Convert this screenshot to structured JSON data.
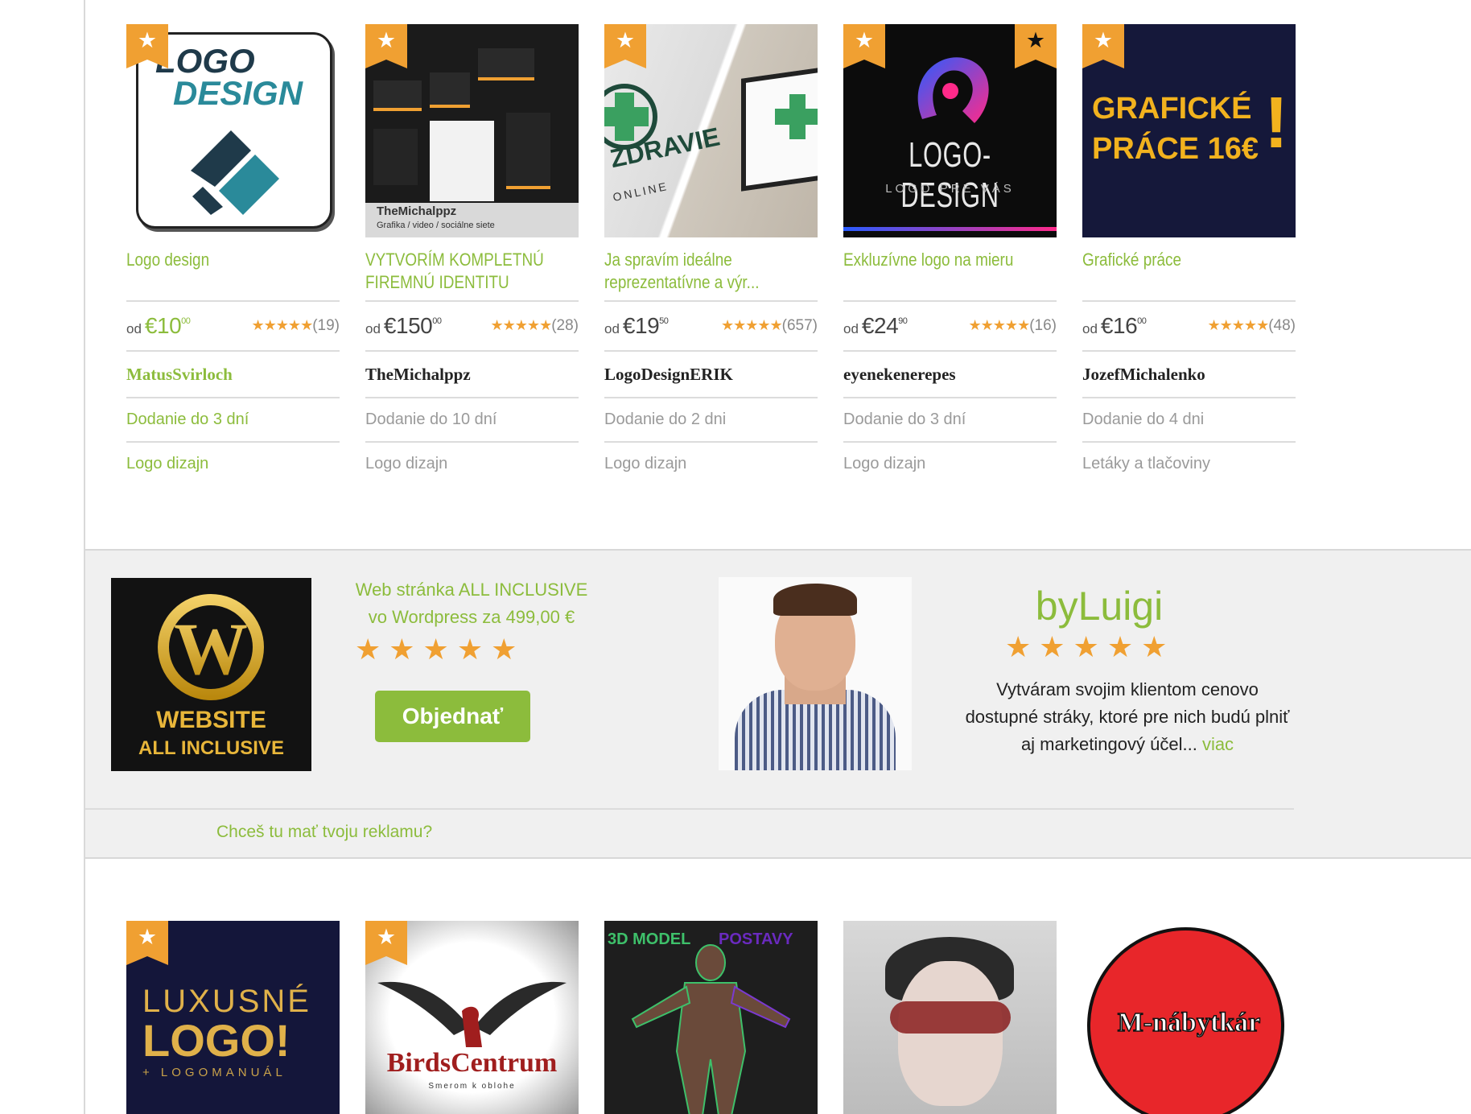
{
  "top_products": [
    {
      "title": "Logo design",
      "price_prefix": "od",
      "price_main": "€10",
      "price_cents": "00",
      "stars": "★★★★★",
      "reviews": "(19)",
      "seller": "MatusSvirloch",
      "delivery": "Dodanie do 3 dní",
      "category": "Logo dizajn",
      "thumb_text_1": "LOGO",
      "thumb_text_2": "DESIGN"
    },
    {
      "title": "VYTVORÍM KOMPLETNÚ FIREMNÚ IDENTITU",
      "price_prefix": "od",
      "price_main": "€150",
      "price_cents": "00",
      "stars": "★★★★★",
      "reviews": "(28)",
      "seller": "TheMichalppz",
      "delivery": "Dodanie do 10 dní",
      "category": "Logo dizajn",
      "thumb_text_1": "TheMichalppz",
      "thumb_text_2": "Grafika / video / sociálne siete"
    },
    {
      "title": "Ja spravím ideálne reprezentatívne a výr...",
      "price_prefix": "od",
      "price_main": "€19",
      "price_cents": "50",
      "stars": "★★★★★",
      "reviews": "(657)",
      "seller": "LogoDesignERIK",
      "delivery": "Dodanie do 2 dni",
      "category": "Logo dizajn",
      "thumb_text_1": "ZDRAVIE",
      "thumb_text_2": "ONLINE"
    },
    {
      "title": "Exkluzívne logo na mieru",
      "price_prefix": "od",
      "price_main": "€24",
      "price_cents": "90",
      "stars": "★★★★★",
      "reviews": "(16)",
      "seller": "eyenekenerepes",
      "delivery": "Dodanie do 3 dní",
      "category": "Logo dizajn",
      "thumb_text_1": "LOGO-DESIGN",
      "thumb_text_2": "LOGO PRE VÁS"
    },
    {
      "title": "Grafické práce",
      "price_prefix": "od",
      "price_main": "€16",
      "price_cents": "00",
      "stars": "★★★★★",
      "reviews": "(48)",
      "seller": "JozefMichalenko",
      "delivery": "Dodanie do 4 dni",
      "category": "Letáky a tlačoviny",
      "thumb_text_1": "GRAFICKÉ",
      "thumb_text_2": "PRÁCE 16€"
    }
  ],
  "ad": {
    "image_text_1": "WEBSITE",
    "image_text_2": "ALL INCLUSIVE",
    "title": "Web stránka ALL INCLUSIVE vo Wordpress za 499,00 €",
    "stars": "★★★★★",
    "order_label": "Objednať",
    "seller_name": "byLuigi",
    "seller_stars": "★★★★★",
    "seller_desc": "Vytváram svojim klientom cenovo dostupné stráky, ktoré pre nich budú plniť aj marketingový účel...",
    "more_label": "viac",
    "cta_link": "Chceš tu mať tvoju reklamu?"
  },
  "bottom_products": [
    {
      "thumb_text_1": "LUXUSNÉ",
      "thumb_text_2": "LOGO!",
      "thumb_text_3": "+ LOGOMANUÁL"
    },
    {
      "thumb_text_1": "BirdsCentrum",
      "thumb_text_2": "Smerom k oblohe"
    },
    {
      "thumb_text_1": "3D MODEL",
      "thumb_text_2": "POSTAVY"
    },
    {
      "thumb_text_1": ""
    },
    {
      "thumb_text_1": "M-nábytkár"
    }
  ],
  "colors": {
    "accent_green": "#8cbc3c",
    "star_orange": "#f0a032",
    "band_bg": "#f0f0f0"
  }
}
